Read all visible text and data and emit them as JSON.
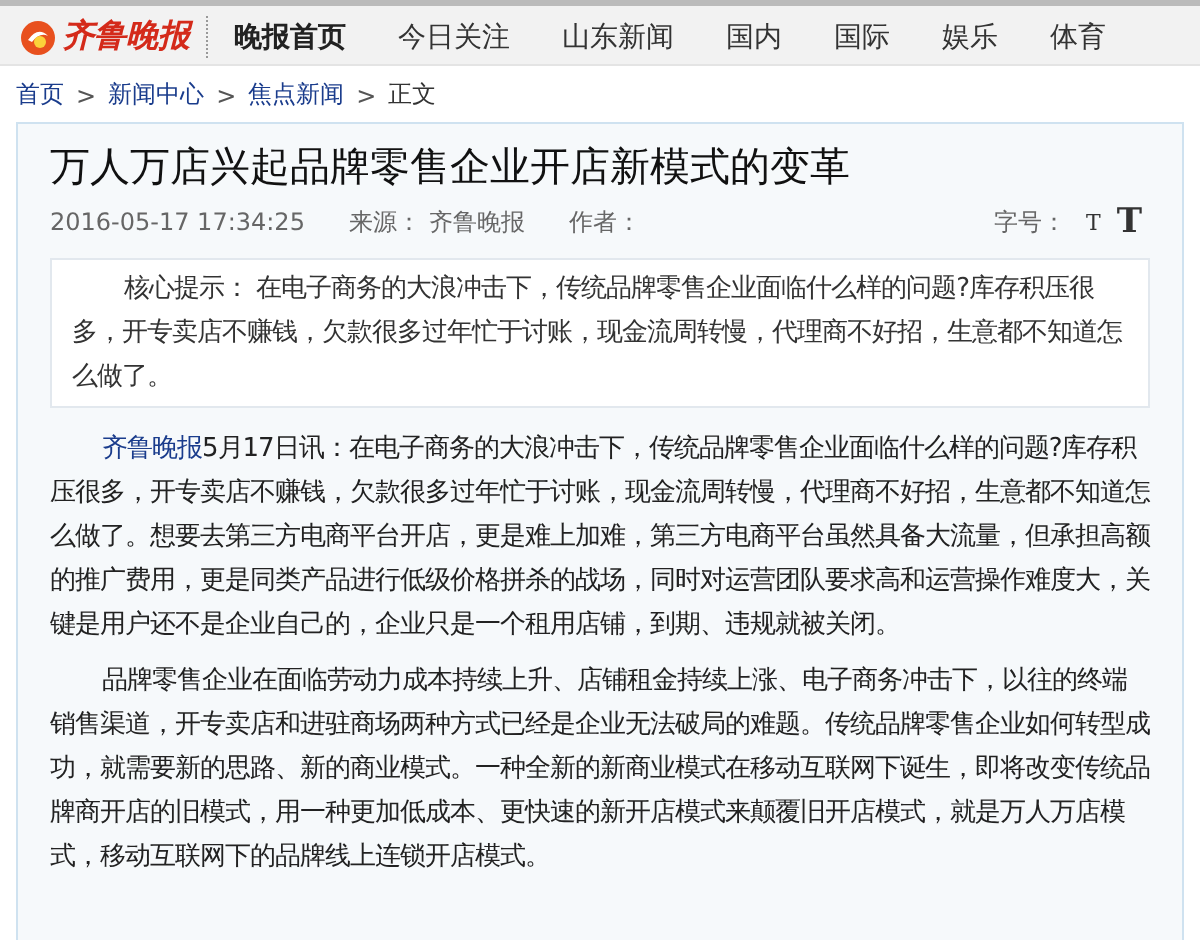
{
  "header": {
    "logo": "齐鲁晚报",
    "nav": [
      {
        "label": "晚报首页",
        "selected": true
      },
      {
        "label": "今日关注",
        "selected": false
      },
      {
        "label": "山东新闻",
        "selected": false
      },
      {
        "label": "国内",
        "selected": false
      },
      {
        "label": "国际",
        "selected": false
      },
      {
        "label": "娱乐",
        "selected": false
      },
      {
        "label": "体育",
        "selected": false
      }
    ]
  },
  "breadcrumb": [
    {
      "label": "首页",
      "kind": "link"
    },
    {
      "label": "新闻中心",
      "kind": "link"
    },
    {
      "label": "焦点新闻",
      "kind": "link"
    },
    {
      "label": "正文",
      "kind": "current"
    }
  ],
  "separator": ">",
  "article": {
    "title": "万人万店兴起品牌零售企业开店新模式的变革",
    "meta": {
      "time": "2016-05-17 17:34:25",
      "source_label": "来源：",
      "source": "齐鲁晚报",
      "author_label": "作者：",
      "font_size_label": "字号：",
      "font_sizes": [
        {
          "label": "T",
          "kind": "small"
        },
        {
          "label": "T",
          "kind": "large"
        }
      ]
    },
    "summary": "核心提示： 在电子商务的大浪冲击下，传统品牌零售企业面临什么样的问题?库存积压很多，开专卖店不赚钱，欠款很多过年忙于讨账，现金流周转慢，代理商不好招，生意都不知道怎么做了。",
    "paragraphs": [
      {
        "link": "齐鲁晚报",
        "text": "5月17日讯：在电子商务的大浪冲击下，传统品牌零售企业面临什么样的问题?库存积压很多，开专卖店不赚钱，欠款很多过年忙于讨账，现金流周转慢，代理商不好招，生意都不知道怎么做了。想要去第三方电商平台开店，更是难上加难，第三方电商平台虽然具备大流量，但承担高额的推广费用，更是同类产品进行低级价格拼杀的战场，同时对运营团队要求高和运营操作难度大，关键是用户还不是企业自己的，企业只是一个租用店铺，到期、违规就被关闭。"
      },
      {
        "text": "品牌零售企业在面临劳动力成本持续上升、店铺租金持续上涨、电子商务冲击下，以往的终端销售渠道，开专卖店和进驻商场两种方式已经是企业无法破局的难题。传统品牌零售企业如何转型成功，就需要新的思路、新的商业模式。一种全新的新商业模式在移动互联网下诞生，即将改变传统品牌商开店的旧模式，用一种更加低成本、更快速的新开店模式来颠覆旧开店模式，就是万人万店模式，移动互联网下的品牌线上连锁开店模式。"
      }
    ]
  }
}
